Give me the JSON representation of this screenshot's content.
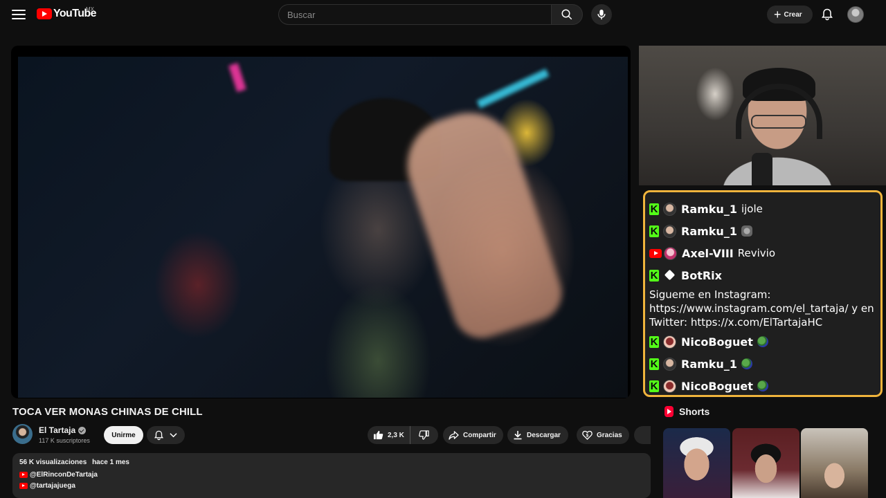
{
  "header": {
    "logo_text": "YouTube",
    "region": "MX",
    "search_placeholder": "Buscar",
    "create_label": "Crear"
  },
  "chat": {
    "messages": [
      {
        "platform": "kick",
        "user": "Ramku_1",
        "text": "ijole"
      },
      {
        "platform": "kick",
        "user": "Ramku_1",
        "emote": "rock-emote"
      },
      {
        "platform": "youtube",
        "user": "Axel-VIII",
        "text": "Revivio"
      },
      {
        "platform": "kick",
        "user": "BotRix",
        "text": "Sigueme en Instagram: https://www.instagram.com/el_tartaja/ y en Twitter: https://x.com/ElTartajaHC"
      },
      {
        "platform": "kick",
        "user": "NicoBoguet",
        "emote": "pepe-emote"
      },
      {
        "platform": "kick",
        "user": "Ramku_1",
        "emote": "pepe-emote"
      },
      {
        "platform": "kick",
        "user": "NicoBoguet",
        "emote": "pepe-emote"
      }
    ]
  },
  "video": {
    "title": "TOCA VER MONAS CHINAS DE CHILL",
    "channel_name": "El Tartaja",
    "subscribers": "117 K suscriptores",
    "join_label": "Unirme",
    "likes": "2,3 K",
    "share_label": "Compartir",
    "download_label": "Descargar",
    "thanks_label": "Gracias"
  },
  "description": {
    "views": "56 K visualizaciones",
    "date": "hace 1 mes",
    "links": [
      "@ElRinconDeTartaja",
      "@tartajajuega"
    ]
  },
  "shorts": {
    "title": "Shorts"
  },
  "colors": {
    "background": "#0f0f0f",
    "youtube_red": "#ff0000",
    "kick_green": "#53fc18",
    "chat_border": "#f0b43c",
    "pill_bg": "#272727"
  }
}
